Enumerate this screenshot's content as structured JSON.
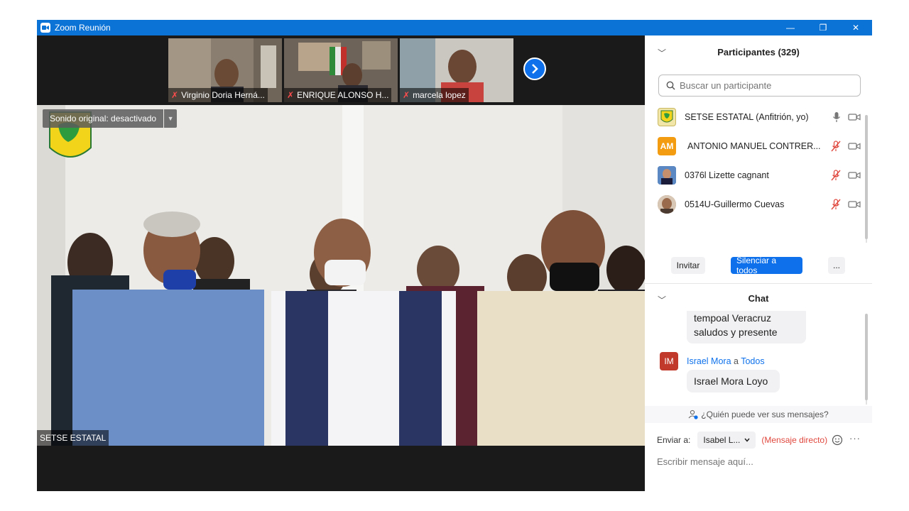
{
  "window": {
    "title": "Zoom Reunión",
    "minimize": "—",
    "restore": "❐",
    "close": "✕"
  },
  "thumbnails": [
    {
      "name": "Virginio Doria Herná..."
    },
    {
      "name": "ENRIQUE ALONSO H..."
    },
    {
      "name": "marcela lopez"
    }
  ],
  "main_video": {
    "sound_label": "Sonido original: desactivado",
    "speaker_name": "SETSE ESTATAL"
  },
  "participants": {
    "title": "Participantes (329)",
    "search_placeholder": "Buscar un participante",
    "list": [
      {
        "name": "SETSE ESTATAL (Anfitrión, yo)",
        "avatar": "",
        "mic": "mic-icon"
      },
      {
        "name": "ANTONIO MANUEL CONTRER...",
        "avatar": "AM",
        "mic": "mic-muted-icon"
      },
      {
        "name": "0376l Lizette cagnant",
        "avatar": "",
        "mic": "mic-muted-icon"
      },
      {
        "name": "0514U-Guillermo Cuevas",
        "avatar": "",
        "mic": "mic-muted-icon"
      }
    ],
    "invite_label": "Invitar",
    "mute_all_label": "Silenciar a todos",
    "more_label": "..."
  },
  "chat": {
    "title": "Chat",
    "partial_message": "tempoal Veracruz\nsaludos y presente",
    "sender": "Israel Mora",
    "sender_connector": "a",
    "recipient": "Todos",
    "avatar": "IM",
    "message": "Israel Mora Loyo",
    "who_can_see": "¿Quién puede ver sus mensajes?",
    "send_to_label": "Enviar a:",
    "send_to_value": "Isabel L...",
    "direct_label": "(Mensaje directo)",
    "input_placeholder": "Escribir mensaje aquí..."
  },
  "colors": {
    "accent": "#0e71eb",
    "titlebar": "#0b72d6",
    "muted_mic": "#e0483e"
  }
}
